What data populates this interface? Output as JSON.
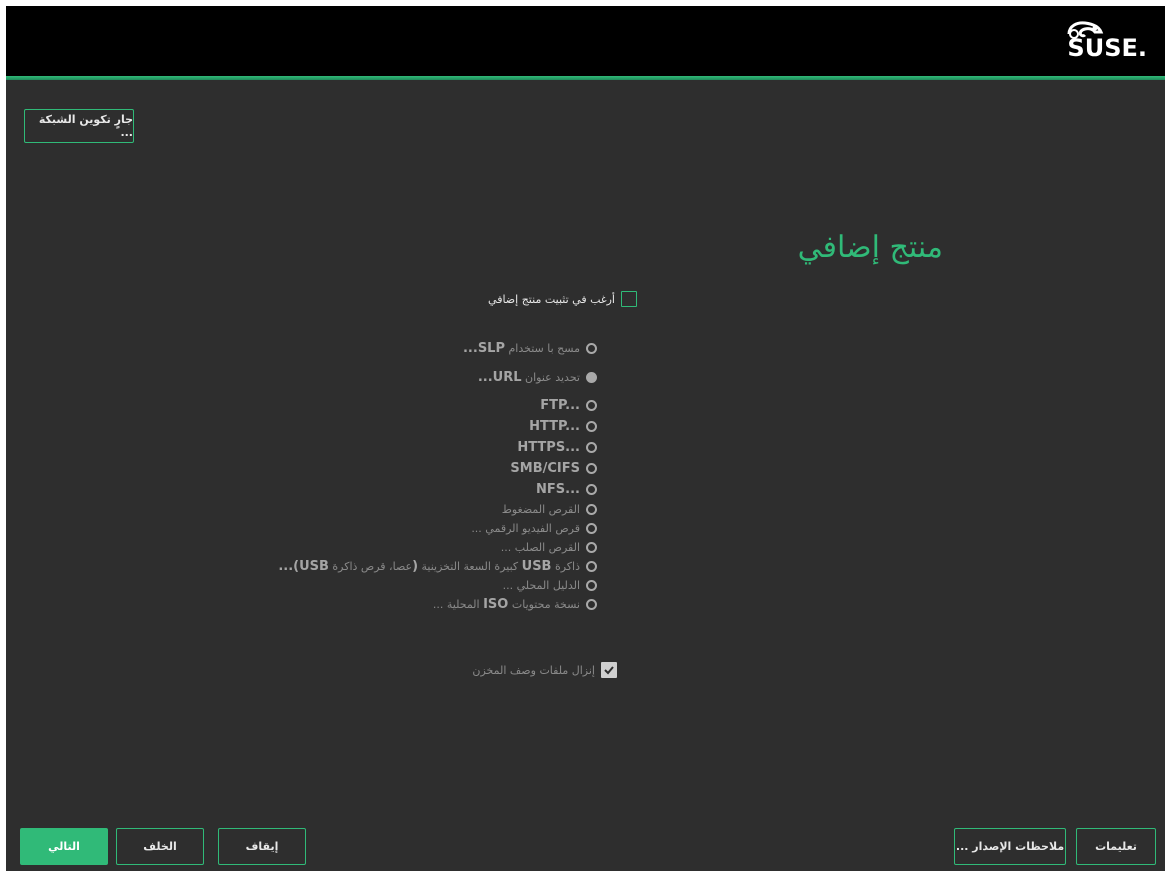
{
  "header": {
    "logo_text": "SUSE."
  },
  "colors": {
    "accent": "#30ba78",
    "background": "#2e2e2e",
    "header": "#000000"
  },
  "network_button": "جارٍ تكوين الشبكة ...",
  "page_title": "منتج إضافي",
  "install_addon_checkbox": {
    "label": "أرغب في تثبيت منتج إضافي",
    "checked": false
  },
  "sources": {
    "scan_slp": {
      "prefix": "مسح با ستخدام ",
      "bold": "SLP..."
    },
    "specify_url": {
      "prefix": "تحديد عنوان ",
      "bold": "URL..."
    },
    "ftp": "FTP...",
    "http": "HTTP...",
    "https": "HTTPS...",
    "smb": "SMB/CIFS",
    "nfs": "NFS...",
    "cd": "القرص المضغوط",
    "dvd": "قرص الفيديو الرقمي ...",
    "hdd": "القرص الصلب ...",
    "usb": {
      "p1": "ذاكرة ",
      "b1": "USB",
      "p2": " كبيرة السعة التخزينية ",
      "b2": "(",
      "p3": "عصا، قرص ذاكرة ",
      "b3": "USB)..."
    },
    "local_dir": "الدليل المحلي ...",
    "iso": {
      "prefix": "نسخة محتويات ",
      "bold": "ISO",
      "suffix": " المحلية ..."
    }
  },
  "download_checkbox": {
    "label": "إنزال ملفات وصف المخزن",
    "checked": true
  },
  "footer": {
    "next": "التالي",
    "back": "الخلف",
    "abort": "إيقاف",
    "release_notes": "ملاحظات الإصدار ...",
    "help": "تعليمات"
  }
}
